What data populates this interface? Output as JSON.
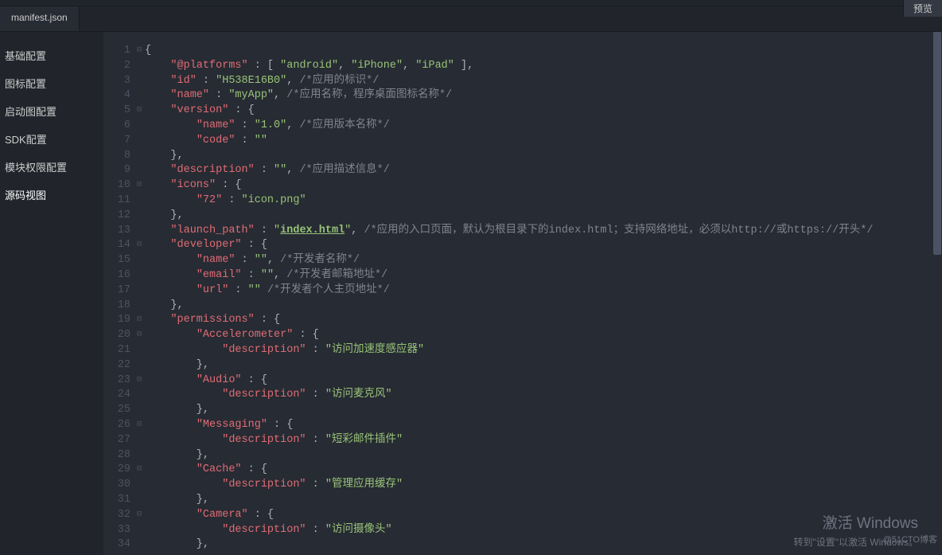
{
  "topbar": {
    "preview": "预览"
  },
  "tab": {
    "label": "manifest.json"
  },
  "sidebar": {
    "items": [
      {
        "label": "基础配置"
      },
      {
        "label": "图标配置"
      },
      {
        "label": "启动图配置"
      },
      {
        "label": "SDK配置"
      },
      {
        "label": "模块权限配置"
      },
      {
        "label": "源码视图"
      }
    ]
  },
  "lines": [
    {
      "n": "1",
      "fold": "⊟",
      "seg": [
        {
          "t": "{",
          "c": "p"
        }
      ]
    },
    {
      "n": "2",
      "fold": "",
      "seg": [
        {
          "t": "    ",
          "c": "p"
        },
        {
          "t": "\"@platforms\"",
          "c": "k"
        },
        {
          "t": " : [ ",
          "c": "p"
        },
        {
          "t": "\"android\"",
          "c": "s"
        },
        {
          "t": ", ",
          "c": "p"
        },
        {
          "t": "\"iPhone\"",
          "c": "s"
        },
        {
          "t": ", ",
          "c": "p"
        },
        {
          "t": "\"iPad\"",
          "c": "s"
        },
        {
          "t": " ],",
          "c": "p"
        }
      ]
    },
    {
      "n": "3",
      "fold": "",
      "seg": [
        {
          "t": "    ",
          "c": "p"
        },
        {
          "t": "\"id\"",
          "c": "k"
        },
        {
          "t": " : ",
          "c": "p"
        },
        {
          "t": "\"H538E16B0\"",
          "c": "s"
        },
        {
          "t": ", ",
          "c": "p"
        },
        {
          "t": "/*应用的标识*/",
          "c": "c"
        }
      ]
    },
    {
      "n": "4",
      "fold": "",
      "seg": [
        {
          "t": "    ",
          "c": "p"
        },
        {
          "t": "\"name\"",
          "c": "k"
        },
        {
          "t": " : ",
          "c": "p"
        },
        {
          "t": "\"myApp\"",
          "c": "s"
        },
        {
          "t": ", ",
          "c": "p"
        },
        {
          "t": "/*应用名称，程序桌面图标名称*/",
          "c": "c"
        }
      ]
    },
    {
      "n": "5",
      "fold": "⊟",
      "seg": [
        {
          "t": "    ",
          "c": "p"
        },
        {
          "t": "\"version\"",
          "c": "k"
        },
        {
          "t": " : {",
          "c": "p"
        }
      ]
    },
    {
      "n": "6",
      "fold": "",
      "seg": [
        {
          "t": "        ",
          "c": "p"
        },
        {
          "t": "\"name\"",
          "c": "k"
        },
        {
          "t": " : ",
          "c": "p"
        },
        {
          "t": "\"1.0\"",
          "c": "s"
        },
        {
          "t": ", ",
          "c": "p"
        },
        {
          "t": "/*应用版本名称*/",
          "c": "c"
        }
      ]
    },
    {
      "n": "7",
      "fold": "",
      "seg": [
        {
          "t": "        ",
          "c": "p"
        },
        {
          "t": "\"code\"",
          "c": "k"
        },
        {
          "t": " : ",
          "c": "p"
        },
        {
          "t": "\"\"",
          "c": "s"
        }
      ]
    },
    {
      "n": "8",
      "fold": "",
      "seg": [
        {
          "t": "    },",
          "c": "p"
        }
      ]
    },
    {
      "n": "9",
      "fold": "",
      "seg": [
        {
          "t": "    ",
          "c": "p"
        },
        {
          "t": "\"description\"",
          "c": "k"
        },
        {
          "t": " : ",
          "c": "p"
        },
        {
          "t": "\"\"",
          "c": "s"
        },
        {
          "t": ", ",
          "c": "p"
        },
        {
          "t": "/*应用描述信息*/",
          "c": "c"
        }
      ]
    },
    {
      "n": "10",
      "fold": "⊟",
      "seg": [
        {
          "t": "    ",
          "c": "p"
        },
        {
          "t": "\"icons\"",
          "c": "k"
        },
        {
          "t": " : {",
          "c": "p"
        }
      ]
    },
    {
      "n": "11",
      "fold": "",
      "seg": [
        {
          "t": "        ",
          "c": "p"
        },
        {
          "t": "\"72\"",
          "c": "k"
        },
        {
          "t": " : ",
          "c": "p"
        },
        {
          "t": "\"icon.png\"",
          "c": "s"
        }
      ]
    },
    {
      "n": "12",
      "fold": "",
      "seg": [
        {
          "t": "    },",
          "c": "p"
        }
      ]
    },
    {
      "n": "13",
      "fold": "",
      "seg": [
        {
          "t": "    ",
          "c": "p"
        },
        {
          "t": "\"launch_path\"",
          "c": "k"
        },
        {
          "t": " : ",
          "c": "p"
        },
        {
          "t": "\"",
          "c": "s"
        },
        {
          "t": "index.html",
          "c": "link"
        },
        {
          "t": "\"",
          "c": "s"
        },
        {
          "t": ", ",
          "c": "p"
        },
        {
          "t": "/*应用的入口页面，默认为根目录下的index.html；支持网络地址，必须以http://或https://开头*/",
          "c": "c"
        }
      ]
    },
    {
      "n": "14",
      "fold": "⊟",
      "seg": [
        {
          "t": "    ",
          "c": "p"
        },
        {
          "t": "\"developer\"",
          "c": "k"
        },
        {
          "t": " : {",
          "c": "p"
        }
      ]
    },
    {
      "n": "15",
      "fold": "",
      "seg": [
        {
          "t": "        ",
          "c": "p"
        },
        {
          "t": "\"name\"",
          "c": "k"
        },
        {
          "t": " : ",
          "c": "p"
        },
        {
          "t": "\"\"",
          "c": "s"
        },
        {
          "t": ", ",
          "c": "p"
        },
        {
          "t": "/*开发者名称*/",
          "c": "c"
        }
      ]
    },
    {
      "n": "16",
      "fold": "",
      "seg": [
        {
          "t": "        ",
          "c": "p"
        },
        {
          "t": "\"email\"",
          "c": "k"
        },
        {
          "t": " : ",
          "c": "p"
        },
        {
          "t": "\"\"",
          "c": "s"
        },
        {
          "t": ", ",
          "c": "p"
        },
        {
          "t": "/*开发者邮箱地址*/",
          "c": "c"
        }
      ]
    },
    {
      "n": "17",
      "fold": "",
      "seg": [
        {
          "t": "        ",
          "c": "p"
        },
        {
          "t": "\"url\"",
          "c": "k"
        },
        {
          "t": " : ",
          "c": "p"
        },
        {
          "t": "\"\"",
          "c": "s"
        },
        {
          "t": " ",
          "c": "p"
        },
        {
          "t": "/*开发者个人主页地址*/",
          "c": "c"
        }
      ]
    },
    {
      "n": "18",
      "fold": "",
      "seg": [
        {
          "t": "    },",
          "c": "p"
        }
      ]
    },
    {
      "n": "19",
      "fold": "⊟",
      "seg": [
        {
          "t": "    ",
          "c": "p"
        },
        {
          "t": "\"permissions\"",
          "c": "k"
        },
        {
          "t": " : {",
          "c": "p"
        }
      ]
    },
    {
      "n": "20",
      "fold": "⊟",
      "seg": [
        {
          "t": "        ",
          "c": "p"
        },
        {
          "t": "\"Accelerometer\"",
          "c": "k"
        },
        {
          "t": " : {",
          "c": "p"
        }
      ]
    },
    {
      "n": "21",
      "fold": "",
      "seg": [
        {
          "t": "            ",
          "c": "p"
        },
        {
          "t": "\"description\"",
          "c": "k"
        },
        {
          "t": " : ",
          "c": "p"
        },
        {
          "t": "\"访问加速度感应器\"",
          "c": "s"
        }
      ]
    },
    {
      "n": "22",
      "fold": "",
      "seg": [
        {
          "t": "        },",
          "c": "p"
        }
      ]
    },
    {
      "n": "23",
      "fold": "⊟",
      "seg": [
        {
          "t": "        ",
          "c": "p"
        },
        {
          "t": "\"Audio\"",
          "c": "k"
        },
        {
          "t": " : {",
          "c": "p"
        }
      ]
    },
    {
      "n": "24",
      "fold": "",
      "seg": [
        {
          "t": "            ",
          "c": "p"
        },
        {
          "t": "\"description\"",
          "c": "k"
        },
        {
          "t": " : ",
          "c": "p"
        },
        {
          "t": "\"访问麦克风\"",
          "c": "s"
        }
      ]
    },
    {
      "n": "25",
      "fold": "",
      "seg": [
        {
          "t": "        },",
          "c": "p"
        }
      ]
    },
    {
      "n": "26",
      "fold": "⊟",
      "seg": [
        {
          "t": "        ",
          "c": "p"
        },
        {
          "t": "\"Messaging\"",
          "c": "k"
        },
        {
          "t": " : {",
          "c": "p"
        }
      ]
    },
    {
      "n": "27",
      "fold": "",
      "seg": [
        {
          "t": "            ",
          "c": "p"
        },
        {
          "t": "\"description\"",
          "c": "k"
        },
        {
          "t": " : ",
          "c": "p"
        },
        {
          "t": "\"短彩邮件插件\"",
          "c": "s"
        }
      ]
    },
    {
      "n": "28",
      "fold": "",
      "seg": [
        {
          "t": "        },",
          "c": "p"
        }
      ]
    },
    {
      "n": "29",
      "fold": "⊟",
      "seg": [
        {
          "t": "        ",
          "c": "p"
        },
        {
          "t": "\"Cache\"",
          "c": "k"
        },
        {
          "t": " : {",
          "c": "p"
        }
      ]
    },
    {
      "n": "30",
      "fold": "",
      "seg": [
        {
          "t": "            ",
          "c": "p"
        },
        {
          "t": "\"description\"",
          "c": "k"
        },
        {
          "t": " : ",
          "c": "p"
        },
        {
          "t": "\"管理应用缓存\"",
          "c": "s"
        }
      ]
    },
    {
      "n": "31",
      "fold": "",
      "seg": [
        {
          "t": "        },",
          "c": "p"
        }
      ]
    },
    {
      "n": "32",
      "fold": "⊟",
      "seg": [
        {
          "t": "        ",
          "c": "p"
        },
        {
          "t": "\"Camera\"",
          "c": "k"
        },
        {
          "t": " : {",
          "c": "p"
        }
      ]
    },
    {
      "n": "33",
      "fold": "",
      "seg": [
        {
          "t": "            ",
          "c": "p"
        },
        {
          "t": "\"description\"",
          "c": "k"
        },
        {
          "t": " : ",
          "c": "p"
        },
        {
          "t": "\"访问摄像头\"",
          "c": "s"
        }
      ]
    },
    {
      "n": "34",
      "fold": "",
      "seg": [
        {
          "t": "        },",
          "c": "p"
        }
      ]
    }
  ],
  "watermark": {
    "line1": "激活 Windows",
    "line2": "转到\"设置\"以激活 Windows。",
    "line3": "@51CTO博客"
  }
}
